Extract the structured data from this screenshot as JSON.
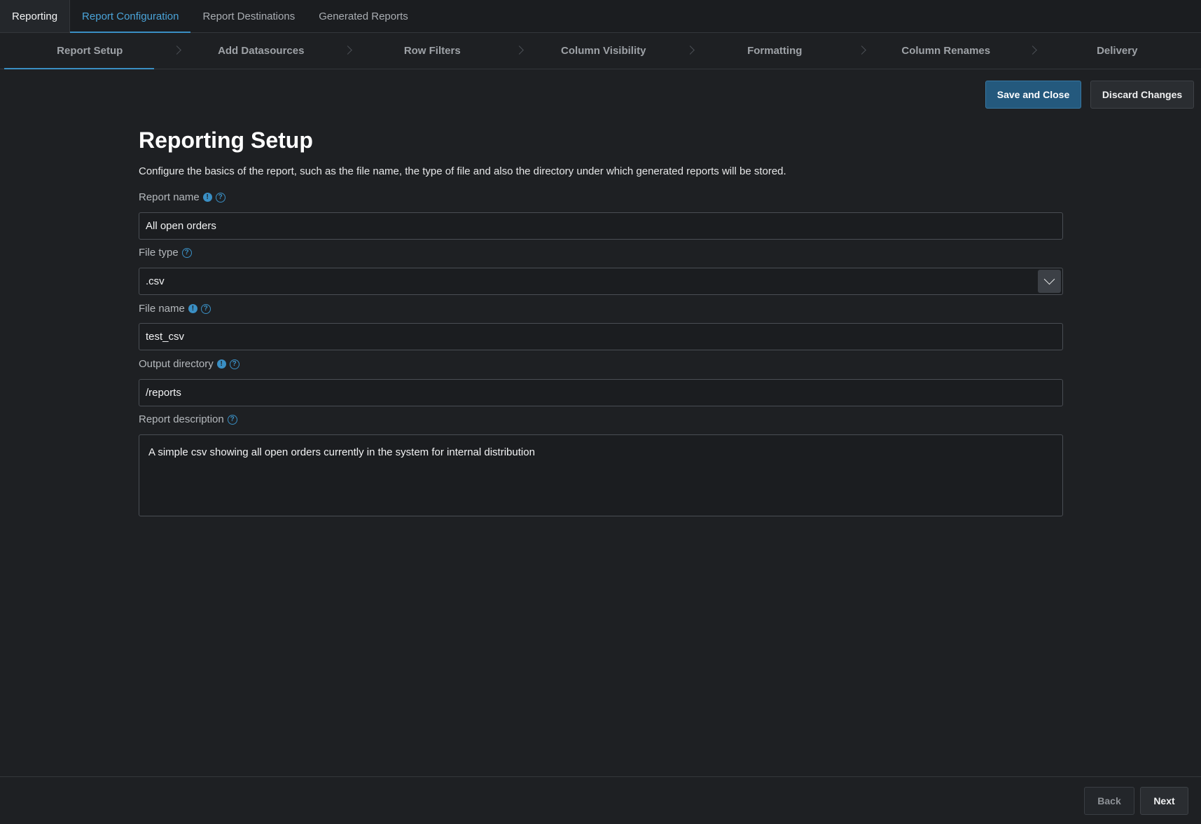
{
  "top_tabs": {
    "reporting": "Reporting",
    "report_configuration": "Report Configuration",
    "report_destinations": "Report Destinations",
    "generated_reports": "Generated Reports"
  },
  "stepper": {
    "steps": [
      "Report Setup",
      "Add Datasources",
      "Row Filters",
      "Column Visibility",
      "Formatting",
      "Column Renames",
      "Delivery"
    ],
    "active_step": "Report Setup"
  },
  "actions": {
    "save_label": "Save and Close",
    "discard_label": "Discard Changes"
  },
  "form": {
    "title": "Reporting Setup",
    "intro": "Configure the basics of the report, such as the file name, the type of file and also the directory under which generated reports will be stored.",
    "report_name": {
      "label": "Report name",
      "value": "All open orders"
    },
    "file_type": {
      "label": "File type",
      "value": ".csv"
    },
    "file_name": {
      "label": "File name",
      "value": "test_csv"
    },
    "output_directory": {
      "label": "Output directory",
      "value": "/reports"
    },
    "report_description": {
      "label": "Report description",
      "value": "A simple csv showing all open orders currently in the system for internal distribution"
    }
  },
  "footer": {
    "back_label": "Back",
    "next_label": "Next"
  },
  "colors": {
    "accent": "#3a8fc4",
    "primary_button": "#24597d",
    "background": "#1e2023"
  }
}
